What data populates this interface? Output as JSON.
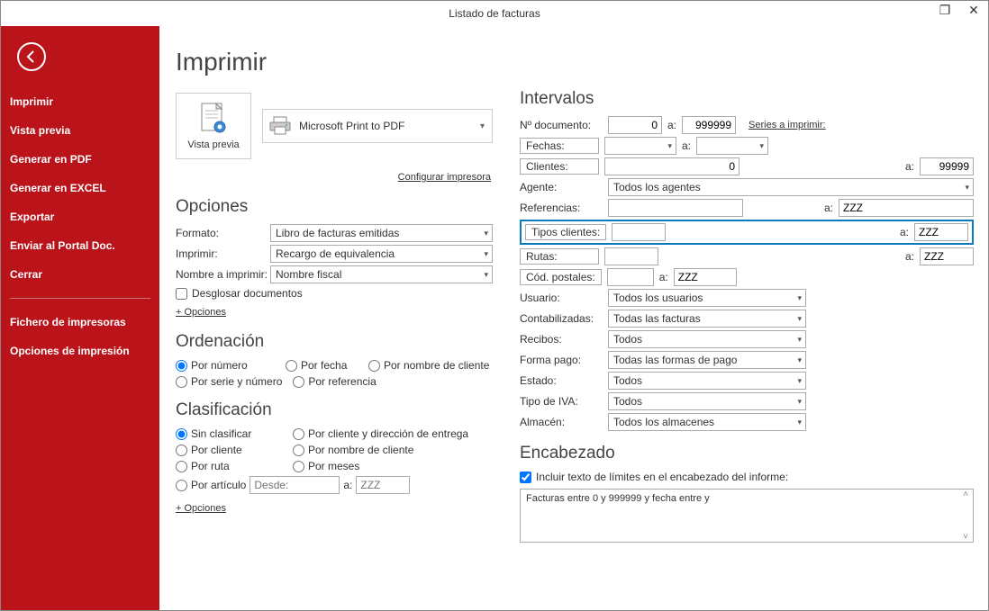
{
  "window": {
    "title": "Listado de facturas"
  },
  "sidebar": {
    "items": [
      "Imprimir",
      "Vista previa",
      "Generar en PDF",
      "Generar en EXCEL",
      "Exportar",
      "Enviar al Portal Doc.",
      "Cerrar"
    ],
    "items2": [
      "Fichero de impresoras",
      "Opciones de impresión"
    ]
  },
  "main": {
    "title": "Imprimir",
    "preview_label": "Vista previa",
    "printer_name": "Microsoft Print to PDF",
    "config_printer": "Configurar impresora",
    "opciones": {
      "heading": "Opciones",
      "formato_lbl": "Formato:",
      "formato_val": "Libro de facturas emitidas",
      "imprimir_lbl": "Imprimir:",
      "imprimir_val": "Recargo de equivalencia",
      "nombre_lbl": "Nombre a imprimir:",
      "nombre_val": "Nombre fiscal",
      "desglosar": "Desglosar documentos",
      "mas": "+ Opciones"
    },
    "ordenacion": {
      "heading": "Ordenación",
      "r1": "Por número",
      "r2": "Por fecha",
      "r3": "Por nombre de cliente",
      "r4": "Por serie y número",
      "r5": "Por referencia"
    },
    "clasificacion": {
      "heading": "Clasificación",
      "r1": "Sin clasificar",
      "r2": "Por cliente y dirección de entrega",
      "r3": "Por cliente",
      "r4": "Por nombre de cliente",
      "r5": "Por ruta",
      "r6": "Por meses",
      "r7": "Por artículo",
      "desde": "Desde:",
      "a": "a:",
      "hasta": "ZZZ",
      "mas": "+ Opciones"
    }
  },
  "intervalos": {
    "heading": "Intervalos",
    "ndoc_lbl": "Nº documento:",
    "ndoc_from": "0",
    "ndoc_to": "999999",
    "series_link": "Series a imprimir:",
    "fechas_lbl": "Fechas:",
    "clientes_lbl": "Clientes:",
    "clientes_from": "0",
    "clientes_to": "99999",
    "agente_lbl": "Agente:",
    "agente_val": "Todos los agentes",
    "ref_lbl": "Referencias:",
    "ref_to": "ZZZ",
    "tipos_lbl": "Tipos clientes:",
    "tipos_to": "ZZZ",
    "rutas_lbl": "Rutas:",
    "rutas_to": "ZZZ",
    "cp_lbl": "Cód. postales:",
    "cp_to": "ZZZ",
    "usuario_lbl": "Usuario:",
    "usuario_val": "Todos los usuarios",
    "contab_lbl": "Contabilizadas:",
    "contab_val": "Todas las facturas",
    "recibos_lbl": "Recibos:",
    "recibos_val": "Todos",
    "forma_lbl": "Forma pago:",
    "forma_val": "Todas las formas de pago",
    "estado_lbl": "Estado:",
    "estado_val": "Todos",
    "iva_lbl": "Tipo de IVA:",
    "iva_val": "Todos",
    "almacen_lbl": "Almacén:",
    "almacen_val": "Todos los almacenes",
    "a": "a:"
  },
  "encabezado": {
    "heading": "Encabezado",
    "chk": "Incluir texto de límites en el encabezado del informe:",
    "text": "Facturas entre 0 y 999999 y fecha entre  y"
  }
}
